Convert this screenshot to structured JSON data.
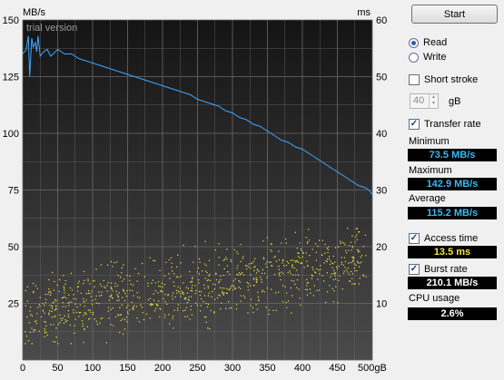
{
  "chart_data": [
    {
      "type": "line",
      "title": "",
      "watermark": "trial version",
      "xlabel": "",
      "x_unit": "gB",
      "ylabel": "MB/s",
      "y2label": "ms",
      "xlim": [
        0,
        500
      ],
      "ylim": [
        0,
        150
      ],
      "y2lim": [
        0,
        60
      ],
      "x_ticks": [
        "0",
        "50",
        "100",
        "150",
        "200",
        "250",
        "300",
        "350",
        "400",
        "450",
        "500gB"
      ],
      "y_ticks": [
        "25",
        "50",
        "75",
        "100",
        "125",
        "150"
      ],
      "y2_ticks": [
        "10",
        "20",
        "30",
        "40",
        "50",
        "60"
      ],
      "grid": true,
      "series": [
        {
          "color": "#3ea6ff",
          "x": [
            0,
            5,
            8,
            10,
            13,
            15,
            18,
            20,
            22,
            25,
            30,
            35,
            40,
            50,
            60,
            70,
            80,
            90,
            100,
            110,
            120,
            130,
            140,
            150,
            160,
            170,
            180,
            190,
            200,
            210,
            220,
            230,
            240,
            250,
            260,
            270,
            280,
            290,
            300,
            310,
            320,
            330,
            340,
            350,
            360,
            370,
            380,
            390,
            400,
            410,
            420,
            430,
            440,
            450,
            460,
            470,
            480,
            490,
            495,
            500
          ],
          "y": [
            135,
            137,
            143,
            125,
            142,
            138,
            140,
            136,
            143,
            134,
            136,
            137,
            134,
            137,
            135,
            135,
            133,
            132,
            131,
            130,
            129,
            128,
            127,
            126,
            125,
            124,
            123,
            122,
            121,
            120,
            119,
            118,
            117,
            115,
            114,
            113,
            112,
            110,
            109,
            107,
            106,
            104,
            103,
            101,
            99,
            97,
            96,
            94,
            93,
            91,
            89,
            87,
            85,
            83,
            81,
            79,
            77,
            76,
            75,
            73
          ]
        }
      ]
    },
    {
      "type": "scatter",
      "title": "",
      "ylabel": "ms",
      "description_series": "Access time",
      "color": "#f4e640",
      "x_range": [
        0,
        500
      ],
      "y_range_ms": [
        3,
        24
      ],
      "trend_ms_start": 8,
      "trend_ms_end": 18,
      "point_count": 900
    }
  ],
  "panel": {
    "start_label": "Start",
    "read_label": "Read",
    "write_label": "Write",
    "mode_selected": "Read",
    "short_stroke_label": "Short stroke",
    "short_stroke_checked": false,
    "stroke_value": "40",
    "stroke_unit": "gB",
    "transfer_rate_label": "Transfer rate",
    "transfer_rate_checked": true,
    "minimum_label": "Minimum",
    "minimum_value": "73.5 MB/s",
    "maximum_label": "Maximum",
    "maximum_value": "142.9 MB/s",
    "average_label": "Average",
    "average_value": "115.2 MB/s",
    "access_time_label": "Access time",
    "access_time_checked": true,
    "access_time_value": "13.5 ms",
    "burst_rate_label": "Burst rate",
    "burst_rate_checked": true,
    "burst_rate_value": "210.1 MB/s",
    "cpu_usage_label": "CPU usage",
    "cpu_usage_value": "2.6%"
  },
  "colors": {
    "transfer_line": "#3ea6ff",
    "access_points": "#f4e640",
    "value_blue": "#3cb8f0",
    "value_yellow": "#f4e640"
  }
}
